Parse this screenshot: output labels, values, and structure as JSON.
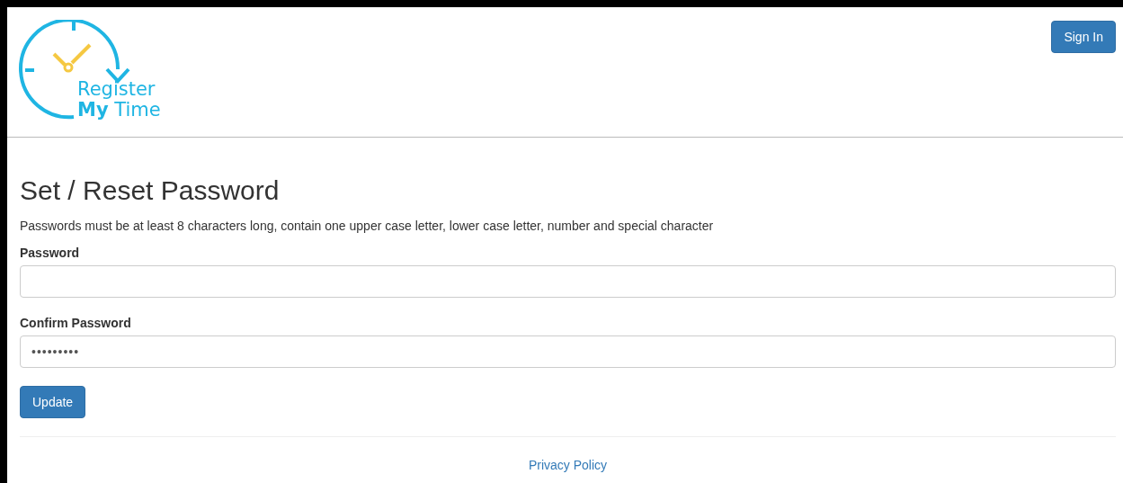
{
  "header": {
    "logo": {
      "line_1": "Register",
      "line_2": "**My** Time"
    },
    "sign_in_button": "Sign In"
  },
  "form": {
    "title": "Set / Reset Password",
    "hint": "Passwords must be at least 8 characters long, contain one upper case letter, lower case letter, number and special character",
    "fields": [
      {
        "label": "Password"
      },
      {
        "label": "Confirm Password",
        "value": "•••••••••"
      }
    ],
    "submit_button": "Update"
  },
  "footer": {
    "link": "Privacy Policy"
  }
}
